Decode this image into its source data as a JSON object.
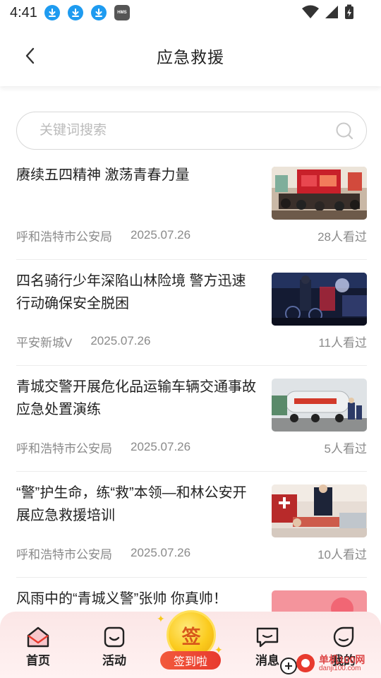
{
  "status_bar": {
    "time": "4:41",
    "icons": [
      "download-icon",
      "download-icon",
      "download-icon",
      "hms-icon",
      "wifi-icon",
      "signal-icon",
      "battery-charging-icon"
    ],
    "hms_label": "HMS"
  },
  "header": {
    "title": "应急救援",
    "back_icon": "chevron-left-icon"
  },
  "search": {
    "placeholder": "关键词搜索",
    "value": "",
    "icon": "search-icon"
  },
  "news": [
    {
      "title": "赓续五四精神 激荡青春力量",
      "source": "呼和浩特市公安局",
      "date": "2025.07.26",
      "views": "28人看过",
      "thumb": "meeting-room-photo"
    },
    {
      "title": "四名骑行少年深陷山林险境 警方迅速行动确保安全脱困",
      "source": "平安新城V",
      "date": "2025.07.26",
      "views": "11人看过",
      "thumb": "night-rescue-photo"
    },
    {
      "title": "青城交警开展危化品运输车辆交通事故应急处置演练",
      "source": "呼和浩特市公安局",
      "date": "2025.07.26",
      "views": "5人看过",
      "thumb": "tanker-truck-photo"
    },
    {
      "title": "“警”护生命，练“救”本领—和林公安开展应急救援培训",
      "source": "呼和浩特市公安局",
      "date": "2025.07.26",
      "views": "10人看过",
      "thumb": "cpr-training-photo"
    },
    {
      "title": "风雨中的“青城义警”张帅 你真帅！",
      "thumb": "red-hearts-photo"
    }
  ],
  "bottom_nav": {
    "items": [
      {
        "label": "首页",
        "icon": "home-icon",
        "active": true
      },
      {
        "label": "活动",
        "icon": "activity-icon",
        "active": false
      },
      {
        "label": "消息",
        "icon": "message-icon",
        "active": false
      },
      {
        "label": "我的",
        "icon": "profile-icon",
        "active": false
      }
    ],
    "sign_in": {
      "coin_char": "签",
      "label": "签到啦"
    }
  },
  "watermark": {
    "text": "单机100网",
    "url": "danji100.com"
  },
  "colors": {
    "accent": "#e83a2e",
    "coin": "#fbcb1e",
    "nav_bg": "#fbe6e6",
    "meta_text": "#8a8a8a"
  }
}
